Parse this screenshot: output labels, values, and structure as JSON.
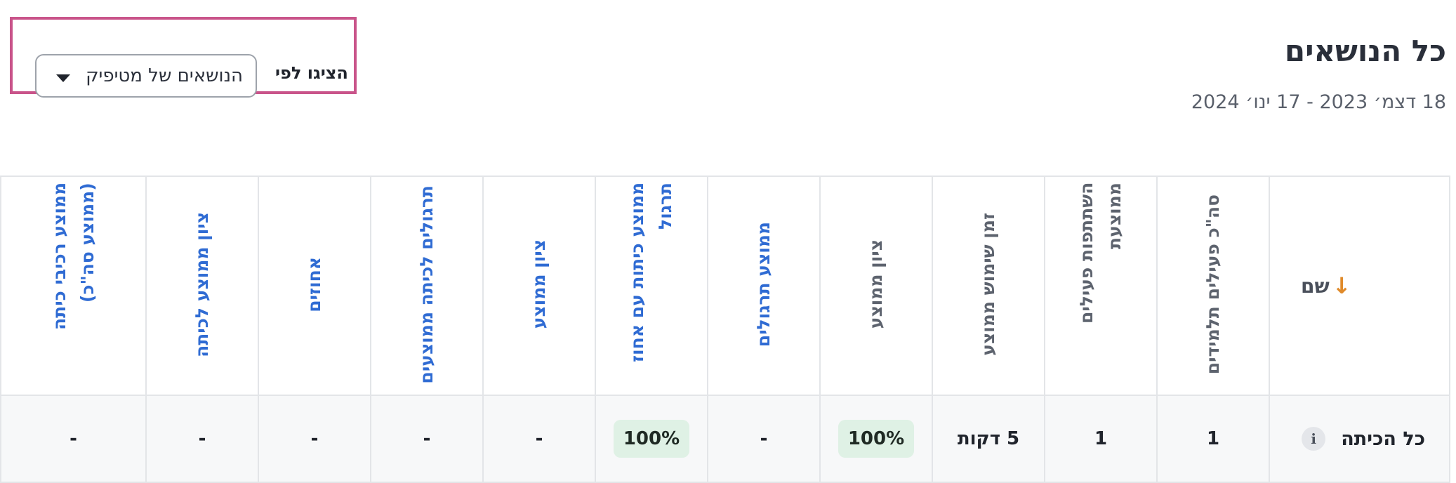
{
  "header": {
    "title": "כל הנושאים",
    "date_range": "18 דצמ׳ 2023 - 17 ינו׳ 2024"
  },
  "filter": {
    "label": "הציגו לפי",
    "selected": "הנושאים של מטיפיק",
    "highlight_color": "#c9548a"
  },
  "table": {
    "name_header": "שם",
    "sort_direction_icon": "arrow-down-icon",
    "columns": [
      "סה\"כ פעילים תלמידים",
      "השתתפות פעילים ממוצעת",
      "זמן שימוש ממוצע",
      "ציון ממוצע",
      "ממוצע תרגולים",
      "ממוצע כיתות עם אחוז תרגול",
      "ציון ממוצע",
      "תרגולים לכיתה ממוצעים",
      "אחוזים",
      "ציון ממוצע לכיתה",
      "ממוצע רכיבי כיתה (ממוצע סה\"כ)"
    ],
    "row": {
      "name": "כל הכיתה",
      "values": [
        "1",
        "1",
        "5 דקות",
        "100%",
        "-",
        "100%",
        "-",
        "-",
        "-",
        "-",
        "-"
      ]
    }
  },
  "colors": {
    "link": "#2f6bd3",
    "badge_bg": "#dff1e5",
    "sort_arrow": "#e08a2a"
  }
}
